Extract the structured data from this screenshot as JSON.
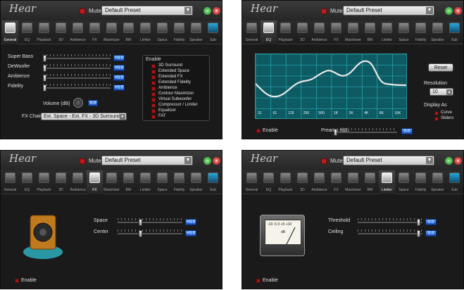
{
  "app": {
    "title": "Hear",
    "mute_label": "Mute",
    "preset": "Default Preset",
    "minimize_icon": "minimize-icon",
    "close_icon": "close-icon"
  },
  "tabs": [
    "General",
    "EQ",
    "Playback",
    "3D",
    "Ambience",
    "FX",
    "Maximizer",
    "BW",
    "Limiter",
    "Space",
    "Fidelity",
    "Speaker",
    "Sub"
  ],
  "general": {
    "sliders": [
      {
        "label": "Super Bass",
        "value": "+0.0"
      },
      {
        "label": "DeWoofer",
        "value": "+0.0"
      },
      {
        "label": "Ambience",
        "value": "+0.0"
      },
      {
        "label": "Fidelity",
        "value": "+0.0"
      }
    ],
    "enable_title": "Enable",
    "enable_items": [
      "3D Surround",
      "Extended Space",
      "Extended FX",
      "Extended Fidelity",
      "Ambience",
      "Contour Maximizer",
      "Virtual Subwoofer",
      "Compressor / Limiter",
      "Equalizer",
      "FAT"
    ],
    "volume_label": "Volume (dB)",
    "volume_value": "0.0",
    "fx_chain_label": "FX Chain",
    "fx_chain_value": "Ext. Space - Ext. FX - 3D Surround"
  },
  "eq": {
    "bands": [
      "31",
      "61",
      "125",
      "250",
      "500",
      "1K",
      "2K",
      "4K",
      "8K",
      "16K"
    ],
    "reset_label": "Reset",
    "resolution_label": "Resolution",
    "resolution_value": "10",
    "display_as_label": "Display As",
    "display_options": [
      "Curve",
      "Sliders"
    ],
    "enable_label": "Enable",
    "preamp_label": "Preamp (dB)",
    "preamp_value": "0.0"
  },
  "fx": {
    "sliders": [
      {
        "label": "Space",
        "value": "+0.0"
      },
      {
        "label": "Center",
        "value": "+0.0"
      }
    ],
    "enable_label": "Enable"
  },
  "limiter": {
    "sliders": [
      {
        "label": "Threshold",
        "value": "0.0"
      },
      {
        "label": "Ceiling",
        "value": "0.0"
      }
    ],
    "meter_scale": "-10 -5 0 +5 +10",
    "meter_unit": "dB",
    "enable_label": "Enable"
  },
  "colors": {
    "background": "#1a1a1a",
    "accent_blue": "#2e7de0",
    "checkbox_red": "#a21616",
    "eq_teal": "#0d5a62"
  }
}
